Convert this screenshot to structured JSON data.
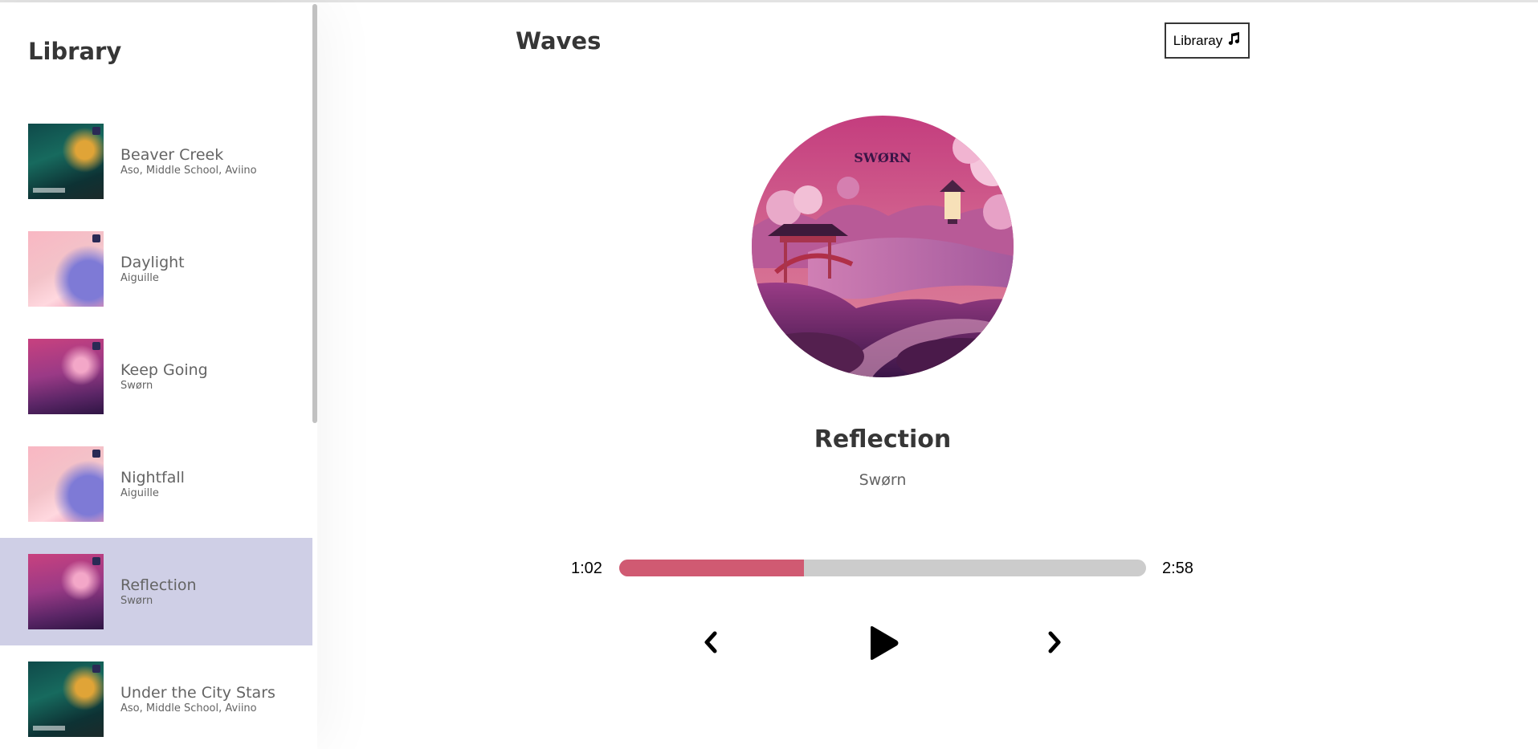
{
  "app": {
    "title": "Waves",
    "library_button_label": "Libraray"
  },
  "library": {
    "title": "Library",
    "songs": [
      {
        "name": "Beaver Creek",
        "artist": "Aso, Middle School, Aviino",
        "cover": "forest-cover-art",
        "active": false
      },
      {
        "name": "Daylight",
        "artist": "Aiguille",
        "cover": "pink-dawn-cover-art",
        "active": false
      },
      {
        "name": "Keep Going",
        "artist": "Swørn",
        "cover": "sworn-cover-art",
        "active": false
      },
      {
        "name": "Nightfall",
        "artist": "Aiguille",
        "cover": "pink-dawn-cover-art",
        "active": false
      },
      {
        "name": "Reflection",
        "artist": "Swørn",
        "cover": "sworn-cover-art",
        "active": true
      },
      {
        "name": "Under the City Stars",
        "artist": "Aso, Middle School, Aviino",
        "cover": "forest-cover-art",
        "active": false
      }
    ]
  },
  "player": {
    "track_title": "Reflection",
    "track_artist": "Swørn",
    "album_logo_text": "SWØRN",
    "current_time": "1:02",
    "total_time": "2:58",
    "progress_fraction": 0.35,
    "state": "paused"
  },
  "icons": {
    "library_button": "music-note-icon",
    "prev": "chevron-left-icon",
    "play": "play-icon",
    "next": "chevron-right-icon"
  },
  "colors": {
    "active_song_bg": "#cfcfe6",
    "progress_fill": "#d05a72",
    "progress_track": "#cccccc",
    "text_dark": "#363636",
    "text_muted": "#646464"
  }
}
